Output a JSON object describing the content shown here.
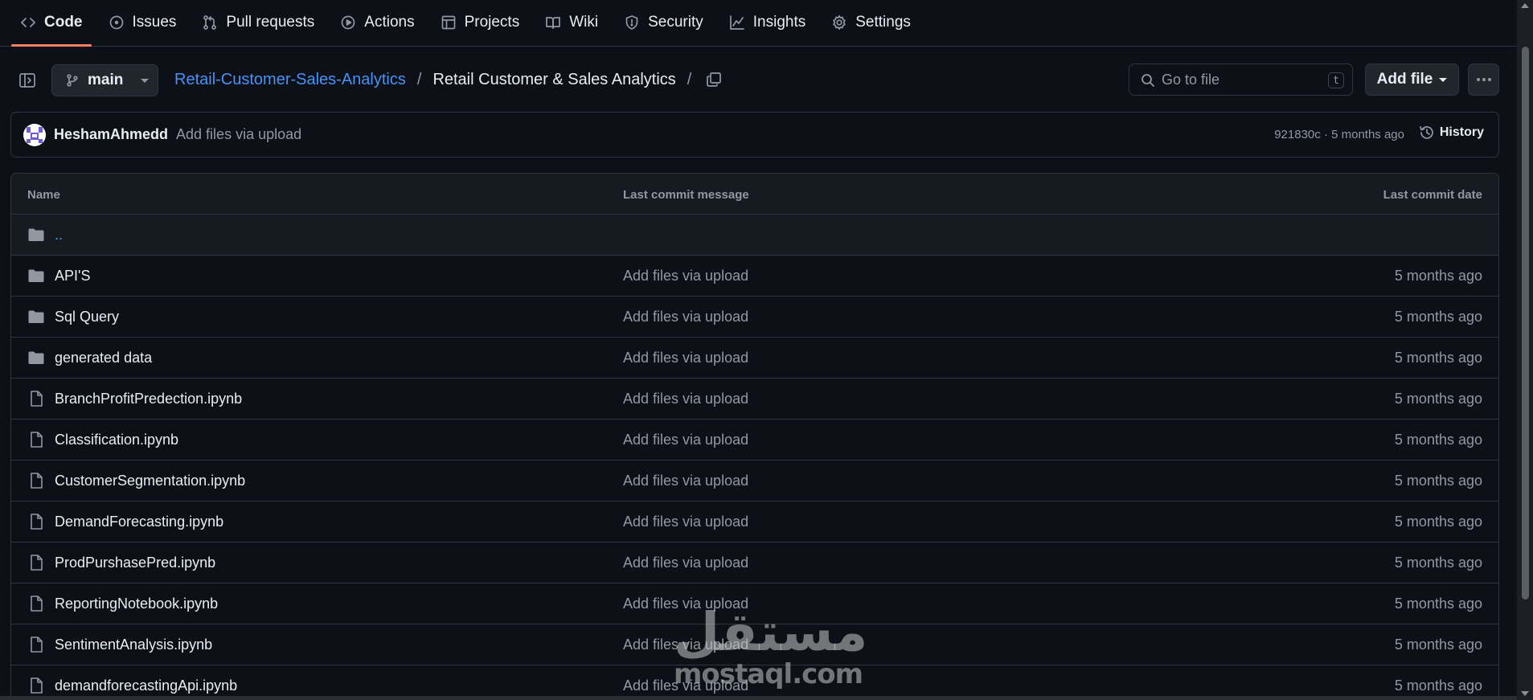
{
  "nav": {
    "tabs": [
      {
        "label": "Code",
        "icon": "code-icon",
        "active": true
      },
      {
        "label": "Issues",
        "icon": "issue-opened-icon"
      },
      {
        "label": "Pull requests",
        "icon": "git-pull-request-icon"
      },
      {
        "label": "Actions",
        "icon": "play-icon"
      },
      {
        "label": "Projects",
        "icon": "table-icon"
      },
      {
        "label": "Wiki",
        "icon": "book-icon"
      },
      {
        "label": "Security",
        "icon": "shield-icon"
      },
      {
        "label": "Insights",
        "icon": "graph-icon"
      },
      {
        "label": "Settings",
        "icon": "gear-icon"
      }
    ]
  },
  "toolbar": {
    "branch": "main",
    "breadcrumb": {
      "repo": "Retail-Customer-Sales-Analytics",
      "separator": "/",
      "folder": "Retail Customer & Sales Analytics",
      "trailing_separator": "/"
    },
    "search_placeholder": "Go to file",
    "search_shortcut": "t",
    "add_file_label": "Add file"
  },
  "commit": {
    "user": "HeshamAhmedd",
    "message": "Add files via upload",
    "meta": "921830c · 5 months ago",
    "history_label": "History"
  },
  "table": {
    "headers": {
      "name": "Name",
      "message": "Last commit message",
      "date": "Last commit date"
    },
    "parent": "..",
    "rows": [
      {
        "type": "folder",
        "name": "API'S",
        "message": "Add files via upload",
        "date": "5 months ago"
      },
      {
        "type": "folder",
        "name": "Sql Query",
        "message": "Add files via upload",
        "date": "5 months ago"
      },
      {
        "type": "folder",
        "name": "generated data",
        "message": "Add files via upload",
        "date": "5 months ago"
      },
      {
        "type": "file",
        "name": "BranchProfitPredection.ipynb",
        "message": "Add files via upload",
        "date": "5 months ago"
      },
      {
        "type": "file",
        "name": "Classification.ipynb",
        "message": "Add files via upload",
        "date": "5 months ago"
      },
      {
        "type": "file",
        "name": "CustomerSegmentation.ipynb",
        "message": "Add files via upload",
        "date": "5 months ago"
      },
      {
        "type": "file",
        "name": "DemandForecasting.ipynb",
        "message": "Add files via upload",
        "date": "5 months ago"
      },
      {
        "type": "file",
        "name": "ProdPurshasePred.ipynb",
        "message": "Add files via upload",
        "date": "5 months ago"
      },
      {
        "type": "file",
        "name": "ReportingNotebook.ipynb",
        "message": "Add files via upload",
        "date": "5 months ago"
      },
      {
        "type": "file",
        "name": "SentimentAnalysis.ipynb",
        "message": "Add files via upload",
        "date": "5 months ago"
      },
      {
        "type": "file",
        "name": "demandforecastingApi.ipynb",
        "message": "Add files via upload",
        "date": "5 months ago"
      }
    ]
  },
  "watermark": {
    "arabic": "مستقل",
    "latin": "mostaql.com"
  },
  "colors": {
    "background": "#0d1117",
    "border": "#30363d",
    "link": "#4493f8",
    "muted": "#9198a1",
    "active_underline": "#f78166"
  }
}
